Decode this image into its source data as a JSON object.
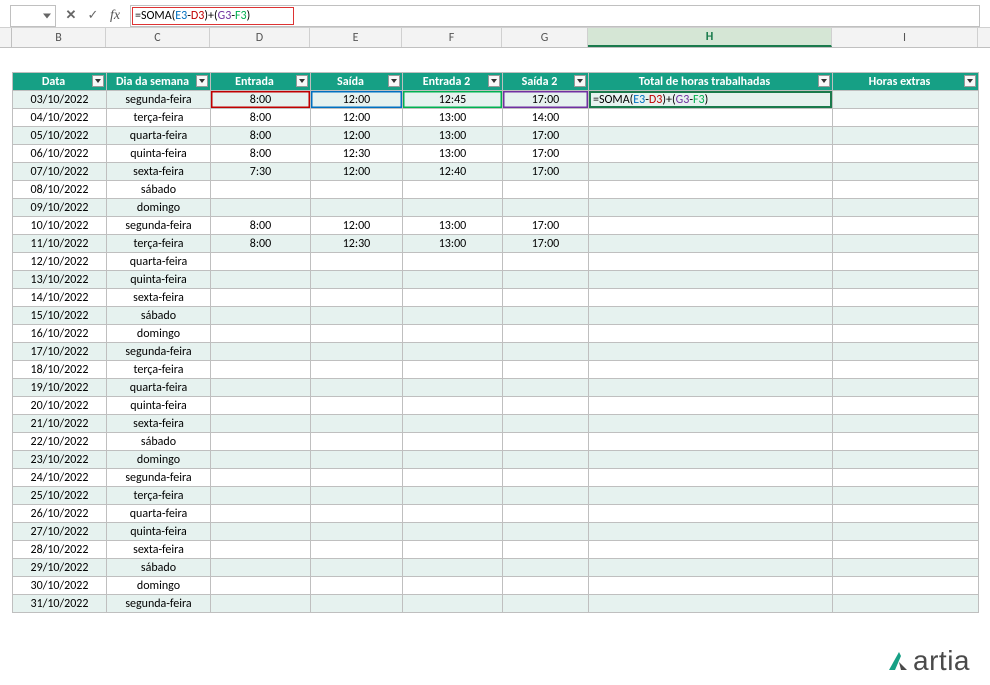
{
  "formula_bar": {
    "name_box": "",
    "cancel_icon": "✕",
    "confirm_icon": "✓",
    "fx_icon": "fx",
    "formula_prefix": "=SOMA(",
    "cell_E3": "E3",
    "sep1": "-",
    "cell_D3": "D3",
    "mid": ")+(",
    "cell_G3": "G3",
    "sep2": "-",
    "cell_F3": "F3",
    "suffix": ")"
  },
  "columns": {
    "B": "B",
    "C": "C",
    "D": "D",
    "E": "E",
    "F": "F",
    "G": "G",
    "H": "H",
    "I": "I"
  },
  "headers": {
    "data": "Data",
    "dia": "Dia da semana",
    "entrada": "Entrada",
    "saida": "Saída",
    "entrada2": "Entrada 2",
    "saida2": "Saída 2",
    "total": "Total de horas trabalhadas",
    "extras": "Horas extras"
  },
  "active_cell_formula": {
    "prefix": "=SOMA(",
    "e3": "E3",
    "m1": "-",
    "d3": "D3",
    "mid": ")+(",
    "g3": "G3",
    "m2": "-",
    "f3": "F3",
    "suffix": ")"
  },
  "rows": [
    {
      "data": "03/10/2022",
      "dia": "segunda-feira",
      "entrada": "8:00",
      "saida": "12:00",
      "entrada2": "12:45",
      "saida2": "17:00",
      "total": "",
      "extras": ""
    },
    {
      "data": "04/10/2022",
      "dia": "terça-feira",
      "entrada": "8:00",
      "saida": "12:00",
      "entrada2": "13:00",
      "saida2": "14:00",
      "total": "",
      "extras": ""
    },
    {
      "data": "05/10/2022",
      "dia": "quarta-feira",
      "entrada": "8:00",
      "saida": "12:00",
      "entrada2": "13:00",
      "saida2": "17:00",
      "total": "",
      "extras": ""
    },
    {
      "data": "06/10/2022",
      "dia": "quinta-feira",
      "entrada": "8:00",
      "saida": "12:30",
      "entrada2": "13:00",
      "saida2": "17:00",
      "total": "",
      "extras": ""
    },
    {
      "data": "07/10/2022",
      "dia": "sexta-feira",
      "entrada": "7:30",
      "saida": "12:00",
      "entrada2": "12:40",
      "saida2": "17:00",
      "total": "",
      "extras": ""
    },
    {
      "data": "08/10/2022",
      "dia": "sábado",
      "entrada": "",
      "saida": "",
      "entrada2": "",
      "saida2": "",
      "total": "",
      "extras": ""
    },
    {
      "data": "09/10/2022",
      "dia": "domingo",
      "entrada": "",
      "saida": "",
      "entrada2": "",
      "saida2": "",
      "total": "",
      "extras": ""
    },
    {
      "data": "10/10/2022",
      "dia": "segunda-feira",
      "entrada": "8:00",
      "saida": "12:00",
      "entrada2": "13:00",
      "saida2": "17:00",
      "total": "",
      "extras": ""
    },
    {
      "data": "11/10/2022",
      "dia": "terça-feira",
      "entrada": "8:00",
      "saida": "12:30",
      "entrada2": "13:00",
      "saida2": "17:00",
      "total": "",
      "extras": ""
    },
    {
      "data": "12/10/2022",
      "dia": "quarta-feira",
      "entrada": "",
      "saida": "",
      "entrada2": "",
      "saida2": "",
      "total": "",
      "extras": ""
    },
    {
      "data": "13/10/2022",
      "dia": "quinta-feira",
      "entrada": "",
      "saida": "",
      "entrada2": "",
      "saida2": "",
      "total": "",
      "extras": ""
    },
    {
      "data": "14/10/2022",
      "dia": "sexta-feira",
      "entrada": "",
      "saida": "",
      "entrada2": "",
      "saida2": "",
      "total": "",
      "extras": ""
    },
    {
      "data": "15/10/2022",
      "dia": "sábado",
      "entrada": "",
      "saida": "",
      "entrada2": "",
      "saida2": "",
      "total": "",
      "extras": ""
    },
    {
      "data": "16/10/2022",
      "dia": "domingo",
      "entrada": "",
      "saida": "",
      "entrada2": "",
      "saida2": "",
      "total": "",
      "extras": ""
    },
    {
      "data": "17/10/2022",
      "dia": "segunda-feira",
      "entrada": "",
      "saida": "",
      "entrada2": "",
      "saida2": "",
      "total": "",
      "extras": ""
    },
    {
      "data": "18/10/2022",
      "dia": "terça-feira",
      "entrada": "",
      "saida": "",
      "entrada2": "",
      "saida2": "",
      "total": "",
      "extras": ""
    },
    {
      "data": "19/10/2022",
      "dia": "quarta-feira",
      "entrada": "",
      "saida": "",
      "entrada2": "",
      "saida2": "",
      "total": "",
      "extras": ""
    },
    {
      "data": "20/10/2022",
      "dia": "quinta-feira",
      "entrada": "",
      "saida": "",
      "entrada2": "",
      "saida2": "",
      "total": "",
      "extras": ""
    },
    {
      "data": "21/10/2022",
      "dia": "sexta-feira",
      "entrada": "",
      "saida": "",
      "entrada2": "",
      "saida2": "",
      "total": "",
      "extras": ""
    },
    {
      "data": "22/10/2022",
      "dia": "sábado",
      "entrada": "",
      "saida": "",
      "entrada2": "",
      "saida2": "",
      "total": "",
      "extras": ""
    },
    {
      "data": "23/10/2022",
      "dia": "domingo",
      "entrada": "",
      "saida": "",
      "entrada2": "",
      "saida2": "",
      "total": "",
      "extras": ""
    },
    {
      "data": "24/10/2022",
      "dia": "segunda-feira",
      "entrada": "",
      "saida": "",
      "entrada2": "",
      "saida2": "",
      "total": "",
      "extras": ""
    },
    {
      "data": "25/10/2022",
      "dia": "terça-feira",
      "entrada": "",
      "saida": "",
      "entrada2": "",
      "saida2": "",
      "total": "",
      "extras": ""
    },
    {
      "data": "26/10/2022",
      "dia": "quarta-feira",
      "entrada": "",
      "saida": "",
      "entrada2": "",
      "saida2": "",
      "total": "",
      "extras": ""
    },
    {
      "data": "27/10/2022",
      "dia": "quinta-feira",
      "entrada": "",
      "saida": "",
      "entrada2": "",
      "saida2": "",
      "total": "",
      "extras": ""
    },
    {
      "data": "28/10/2022",
      "dia": "sexta-feira",
      "entrada": "",
      "saida": "",
      "entrada2": "",
      "saida2": "",
      "total": "",
      "extras": ""
    },
    {
      "data": "29/10/2022",
      "dia": "sábado",
      "entrada": "",
      "saida": "",
      "entrada2": "",
      "saida2": "",
      "total": "",
      "extras": ""
    },
    {
      "data": "30/10/2022",
      "dia": "domingo",
      "entrada": "",
      "saida": "",
      "entrada2": "",
      "saida2": "",
      "total": "",
      "extras": ""
    },
    {
      "data": "31/10/2022",
      "dia": "segunda-feira",
      "entrada": "",
      "saida": "",
      "entrada2": "",
      "saida2": "",
      "total": "",
      "extras": ""
    }
  ],
  "logo_text": "artia"
}
